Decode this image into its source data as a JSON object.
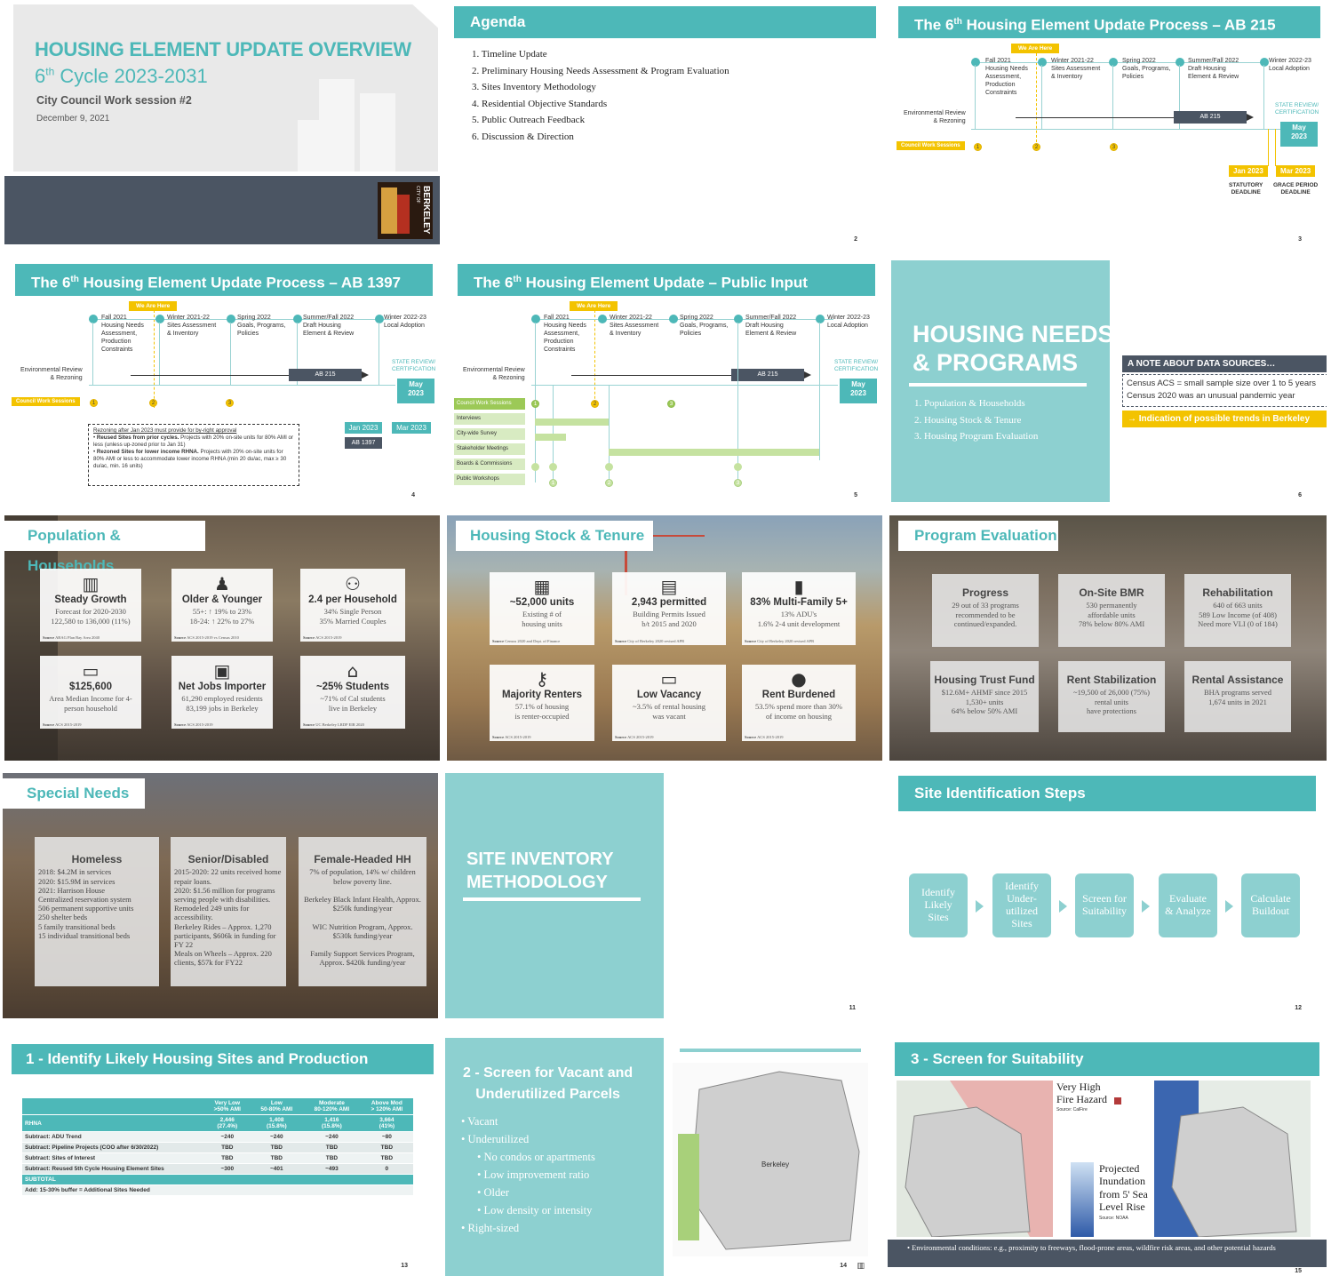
{
  "s1": {
    "title": "HOUSING ELEMENT UPDATE OVERVIEW",
    "cycle": "6",
    "cycle_sup": "th",
    "cycle_rest": " Cycle 2023-2031",
    "subtitle": "City Council Work session #2",
    "date": "December 9, 2021",
    "logo_text": "BERKELEY",
    "logo_small": "CITY OF"
  },
  "s2": {
    "title": "Agenda",
    "items": [
      "1.  Timeline Update",
      "2.  Preliminary Housing Needs Assessment & Program Evaluation",
      "3.  Sites Inventory Methodology",
      "4.  Residential Objective Standards",
      "5.  Public Outreach Feedback",
      "6.  Discussion & Direction"
    ],
    "num": "2"
  },
  "timeline": {
    "we_are_here": "We Are Here",
    "phases": [
      "Fall 2021\nHousing Needs\nAssessment,\nProduction\nConstraints",
      "Winter 2021-22\nSites Assessment\n& Inventory",
      "Spring 2022\nGoals, Programs,\nPolicies",
      "Summer/Fall 2022\nDraft Housing\nElement & Review",
      "Winter 2022-23\nLocal Adoption"
    ],
    "env": "Environmental Review\n& Rezoning",
    "ab215": "AB 215",
    "state_review": "STATE REVIEW/\nCERTIFICATION",
    "may": "May\n2023",
    "council": "Council Work Sessions",
    "n1": "1",
    "n2": "2",
    "n3": "3"
  },
  "s3": {
    "title": "The 6",
    "title_sup": "th",
    "title_rest": " Housing Element Update Process – AB 215",
    "jan": "Jan 2023",
    "mar": "Mar 2023",
    "statutory": "STATUTORY\nDEADLINE",
    "grace": "GRACE PERIOD\nDEADLINE",
    "num": "3"
  },
  "s4": {
    "title": "The 6",
    "title_sup": "th",
    "title_rest": " Housing Element Update Process – AB 1397",
    "jan": "Jan 2023",
    "ab1397": "AB 1397",
    "mar": "Mar 2023",
    "note_head": "Rezoning after Jan 2023 must provide for by-right approval",
    "note_b1a": "Reused Sites from prior cycles.",
    "note_b1b": " Projects with 20% on-site units for 80% AMI or less (unless up-zoned prior to Jan 31)",
    "note_b2a": "Rezoned Sites for lower income RHNA.",
    "note_b2b": " Projects with 20% on-site units for 80% AMI or less to accommodate lower income RHNA (min 20 du/ac, max ≥ 30 du/ac, min. 16 units)",
    "num": "4"
  },
  "s5": {
    "title": "The 6",
    "title_sup": "th",
    "title_rest": " Housing Element Update – Public Input",
    "rows": [
      "Council Work Sessions",
      "Interviews",
      "City-wide Survey",
      "Stakeholder Meetings",
      "Boards & Commissions",
      "Public Workshops"
    ],
    "num": "5"
  },
  "s6": {
    "title": "HOUSING NEEDS\n& PROGRAMS",
    "items": [
      "1.  Population & Households",
      "2.  Housing Stock & Tenure",
      "3.  Housing Program Evaluation"
    ],
    "note_head": "A NOTE ABOUT DATA SOURCES…",
    "note_l1": "Census ACS = small sample size over 1 to 5 years",
    "note_l2": "Census 2020 was an unusual pandemic year",
    "note_trend": "→ Indication of possible trends in Berkeley",
    "num": "6"
  },
  "s7": {
    "title": "Population & Households",
    "cards": [
      {
        "icon": "▥",
        "head": "Steady Growth",
        "body": "Forecast for 2020-2030\n122,580 to 136,000 (11%)",
        "src": "ABAG Plan Bay Area 2040"
      },
      {
        "icon": "♟",
        "head": "Older & Younger",
        "body": "55+: ↑ 19% to 23%\n18-24: ↑ 22% to 27%",
        "src": "ACS 2015-2019 vs Census 2010"
      },
      {
        "icon": "⚇",
        "head": "2.4 per Household",
        "body": "34% Single Person\n35% Married Couples",
        "src": "ACS 2015-2019"
      },
      {
        "icon": "▭",
        "head": "$125,600",
        "body": "Area Median Income for 4-\nperson household",
        "src": "ACS 2015-2019"
      },
      {
        "icon": "▣",
        "head": "Net Jobs Importer",
        "body": "61,290 employed residents\n83,199 jobs in Berkeley",
        "src": "ACS 2015-2019"
      },
      {
        "icon": "⌂",
        "head": "~25% Students",
        "body": "~71% of Cal students\nlive in Berkeley",
        "src": "UC Berkeley LRDP EIR 2020"
      }
    ]
  },
  "s8": {
    "title": "Housing Stock & Tenure",
    "cards": [
      {
        "icon": "▦",
        "head": "~52,000 units",
        "body": "Existing # of\nhousing units",
        "src": "Census 2020 and Dept. of Finance"
      },
      {
        "icon": "▤",
        "head": "2,943 permitted",
        "body": "Building Permits Issued\nb/t 2015 and 2020",
        "src": "City of Berkeley 2020 revised APR"
      },
      {
        "icon": "▮",
        "head": "83% Multi-Family 5+",
        "body": "13% ADU's\n1.6% 2-4 unit development",
        "src": "City of Berkeley 2020 revised APR"
      },
      {
        "icon": "⚷",
        "head": "Majority Renters",
        "body": "57.1% of housing\nis renter-occupied",
        "src": "ACS 2015-2019"
      },
      {
        "icon": "▭",
        "head": "Low Vacancy",
        "body": "~3.5% of rental housing\nwas vacant",
        "src": "ACS 2015-2019"
      },
      {
        "icon": "●",
        "head": "Rent Burdened",
        "body": "53.5% spend more than 30%\nof income on housing",
        "src": "ACS 2015-2019"
      }
    ]
  },
  "s9": {
    "title": "Program Evaluation",
    "cards": [
      {
        "head": "Progress",
        "body": "29 out of 33 programs\nrecommended to be\ncontinued/expanded."
      },
      {
        "head": "On-Site BMR",
        "body": "530 permanently\naffordable units\n78% below 80% AMI"
      },
      {
        "head": "Rehabilitation",
        "body": "640 of 663 units\n589 Low Income (of 408)\nNeed more VLI (0 of 184)"
      },
      {
        "head": "Housing Trust Fund",
        "body": "$12.6M+ AHMF since 2015\n1,530+ units\n64% below 50% AMI"
      },
      {
        "head": "Rent Stabilization",
        "body": "~19,500 of 26,000 (75%)\nrental units\nhave protections"
      },
      {
        "head": "Rental Assistance",
        "body": "BHA programs served\n1,674 units in 2021"
      }
    ]
  },
  "s10": {
    "title": "Special Needs",
    "cards": [
      {
        "head": "Homeless",
        "body": "2018: $4.2M in services\n2020: $15.9M in services\n2021: Harrison House\nCentralized reservation system\n506 permanent supportive units\n250 shelter beds\n5 family transitional beds\n15 individual transitional beds"
      },
      {
        "head": "Senior/Disabled",
        "body": "2015-2020: 22 units received home repair loans.\n2020: $1.56 million for programs serving people with disabilities. Remodeled 249 units for accessibility.\nBerkeley Rides – Approx. 1,270 participants, $606k in funding for FY 22\nMeals on Wheels – Approx. 220 clients, $57k for FY22"
      },
      {
        "head": "Female-Headed HH",
        "body": "7% of population, 14% w/ children below poverty line.\n\nBerkeley Black Infant Health, Approx. $250k funding/year\n\nWIC Nutrition Program, Approx. $530k funding/year\n\nFamily Support Services Program, Approx. $420k funding/year"
      }
    ]
  },
  "s11": {
    "title": "SITE INVENTORY\nMETHODOLOGY",
    "num": "11"
  },
  "s12": {
    "title": "Site Identification Steps",
    "steps": [
      "Identify\nLikely\nSites",
      "Identify\nUnder-\nutilized\nSites",
      "Screen for\nSuitability",
      "Evaluate\n& Analyze",
      "Calculate\nBuildout"
    ],
    "num": "12"
  },
  "s13": {
    "title": "1 - Identify Likely Housing Sites and Production",
    "cols": [
      "Very Low\n>50% AMI",
      "Low\n50-80% AMI",
      "Moderate\n80-120% AMI",
      "Above Mod\n> 120% AMI"
    ],
    "rhna_label": "RHNA",
    "rhna": [
      "2,446\n(27.4%)",
      "1,408\n(15.8%)",
      "1,416\n(15.8%)",
      "3,664\n(41%)"
    ],
    "rows": [
      {
        "label": "Subtract: ADU Trend",
        "vals": [
          "~240",
          "~240",
          "~240",
          "~80"
        ]
      },
      {
        "label": "Subtract: Pipeline Projects (COO after 6/30/2022)",
        "vals": [
          "TBD",
          "TBD",
          "TBD",
          "TBD"
        ]
      },
      {
        "label": "Subtract: Sites of Interest",
        "vals": [
          "TBD",
          "TBD",
          "TBD",
          "TBD"
        ]
      },
      {
        "label": "Subtract: Reused 5th Cycle Housing Element Sites",
        "vals": [
          "~300",
          "~401",
          "~493",
          "0"
        ]
      }
    ],
    "subtotal": "SUBTOTAL",
    "add": "Add: 15-30% buffer = Additional Sites Needed",
    "num": "13"
  },
  "s14": {
    "title": "2 - Screen for Vacant and\nUnderutilized Parcels",
    "items": [
      "Vacant",
      "Underutilized"
    ],
    "sub": [
      "No condos or apartments",
      "Low improvement ratio",
      "Older",
      "Low density or intensity"
    ],
    "last": "Right-sized",
    "map_label": "Berkeley",
    "num": "14"
  },
  "s15": {
    "title": "3 - Screen for Suitability",
    "fire": "Very High\nFire Hazard",
    "fire_src": "Source: CalFire",
    "sea": "Projected\nInundation\nfrom 5' Sea\nLevel Rise",
    "sea_src": "Source: NOAA",
    "footer": "Environmental conditions: e.g., proximity to freeways, flood-prone areas, wildfire risk areas, and other potential hazards",
    "num": "15"
  },
  "colors": {
    "teal": "#4db8b8",
    "light_teal": "#8dd0d0",
    "yellow": "#f3c300",
    "dark": "#4b5563",
    "green": "#9cc957"
  }
}
